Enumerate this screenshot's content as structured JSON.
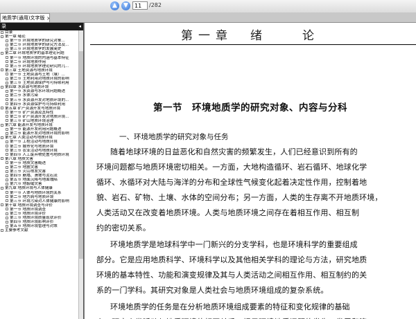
{
  "toolbar": {
    "prev_icon": "up-arrow-icon",
    "next_icon": "down-arrow-icon",
    "page_current": "11",
    "page_total": "/282"
  },
  "tab": {
    "label": "地质学(通用)文字版",
    "close": "×"
  },
  "sidebar": {
    "header": "录",
    "collapse": "◂",
    "items": [
      {
        "label": "目录",
        "level": 0
      },
      {
        "label": "第一章 绪论",
        "level": 0
      },
      {
        "label": "第一节 环境地质学的研究对象...",
        "level": 1
      },
      {
        "label": "第二节 环境地质学的研究方法及...",
        "level": 1
      },
      {
        "label": "第三节 环境地质学的发展简史",
        "level": 1
      },
      {
        "label": "第二章 环境地质学的基本理论问题",
        "level": 0
      },
      {
        "label": "第一节 地质环境的内涵与基本特征",
        "level": 1
      },
      {
        "label": "第二节 环境地质作用",
        "level": 1
      },
      {
        "label": "第三节 环境地质学理论研究的几...",
        "level": 1
      },
      {
        "label": "第三章 土地资源与地质环境",
        "level": 0
      },
      {
        "label": "第一节 土地资源与土地（壤）...",
        "level": 1
      },
      {
        "label": "第二节 土地利用对地质环境的影响",
        "level": 1
      },
      {
        "label": "第三节 土地资源保护与可持续利用",
        "level": 1
      },
      {
        "label": "第四章 水资源与地质环境",
        "level": 0
      },
      {
        "label": "第一节 水资源与水环境问题概述",
        "level": 1
      },
      {
        "label": "第二节 水体污染",
        "level": 1
      },
      {
        "label": "第三节 水资源开发对地质环境的...",
        "level": 1
      },
      {
        "label": "第四节 水资源保护与可持续利用",
        "level": 1
      },
      {
        "label": "第五章 矿产资源开发与地质环境",
        "level": 0
      },
      {
        "label": "第一节 矿产资源及其特性",
        "level": 1
      },
      {
        "label": "第二节 矿产资源开发对地质环境...",
        "level": 1
      },
      {
        "label": "第三节 矿山地质环境治理",
        "level": 1
      },
      {
        "label": "第六章 能源开发与地质环境",
        "level": 0
      },
      {
        "label": "第一节 能源开发利用问题概述",
        "level": 1
      },
      {
        "label": "第二节 能源开发对地质环境的影响",
        "level": 1
      },
      {
        "label": "第七章 人类活动与地质环境",
        "level": 0
      },
      {
        "label": "第一节 工程活动与地质环境",
        "level": 1
      },
      {
        "label": "第二节 城市化与地质环境",
        "level": 1
      },
      {
        "label": "第三节 农业活动与地质环境",
        "level": 1
      },
      {
        "label": "第四节 人工废弃物处置与地质环境",
        "level": 1
      },
      {
        "label": "第八章 地质灾害",
        "level": 0
      },
      {
        "label": "第一节 地质灾害概述",
        "level": 1
      },
      {
        "label": "第二节 地震灾害",
        "level": 1
      },
      {
        "label": "第三节 火山喷发灾害",
        "level": 1
      },
      {
        "label": "第四节 崩塌、滑坡与泥石流",
        "level": 1
      },
      {
        "label": "第五节 地面沉降与地面塌陷",
        "level": 1
      },
      {
        "label": "第六节 地裂缝灾害",
        "level": 1
      },
      {
        "label": "第九章 地质环境与人体健康",
        "level": 0
      },
      {
        "label": "第一节 人体与地质环境的关系",
        "level": 1
      },
      {
        "label": "第二节 地方病与地质环境",
        "level": 1
      },
      {
        "label": "第三节 环境污染对人体健康的影响",
        "level": 1
      },
      {
        "label": "第十章 地质环境调查与评价",
        "level": 0
      },
      {
        "label": "第一节 地质环境调查",
        "level": 1
      },
      {
        "label": "第二节 地质环境评价",
        "level": 1
      },
      {
        "label": "第三节 地质环境质量现状评价",
        "level": 1
      },
      {
        "label": "第四节 地质环境影响评价",
        "level": 1
      },
      {
        "label": "第五节 地质环境管理与对策",
        "level": 1
      },
      {
        "label": "主要参考文献",
        "level": 0
      }
    ]
  },
  "page": {
    "chapter_title": "第一章　绪　　论",
    "section_title": "第一节　环境地质学的研究对象、内容与分科",
    "subsection_title": "一、环境地质学的研究对象与任务",
    "lines": [
      "随着地球环境的日益恶化和自然灾害的频繁发生，人们已经意识到所有的",
      "环境问题都与地质环境密切相关。一方面，大地构造循环、岩石循环、地球化学",
      "循环、水循环对大陆与海洋的分布和全球性气候变化起着决定性作用，控制着地",
      "貌、岩石、矿物、土壤、水体的空间分布；另一方面，人类的生存离不开地质环境，",
      "人类活动又在改变着地质环境。人类与地质环境之间存在着相互作用、相互制",
      "约的密切关系。",
      "环境地质学是地球科学中一门新兴的分支学科，也是环境科学的重要组成",
      "部分。它是应用地质科学、环境科学以及其他相关学科的理论与方法，研究地质",
      "环境的基本特性、功能和演变规律及其与人类活动之间相互作用、相互制约的关",
      "系的一门学科。其研究对象是人类社会与地质环境组成的复杂系统。",
      "环境地质学的任务是在分析地质环境组成要素的特征和变化规律的基础",
      "上，研究人类活动与地质环境的相互关系，揭示环境地质问题的发生、发展和演"
    ]
  }
}
